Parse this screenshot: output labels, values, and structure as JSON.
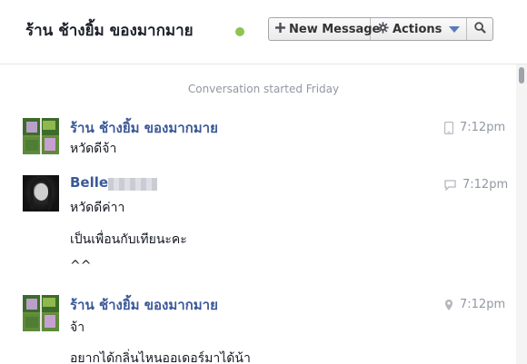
{
  "header": {
    "title": "ร้าน ช้างยิ้ม ของมากมาย",
    "online_color": "#8fc355",
    "new_message_label": "New Message",
    "new_message_icon": "plus-icon",
    "actions_label": "Actions",
    "actions_icon": "gear-icon",
    "search_icon": "search-icon"
  },
  "conversation": {
    "started_text": "Conversation started Friday",
    "messages": [
      {
        "sender": "ร้าน ช้างยิ้ม ของมากมาย",
        "time": "7:12pm",
        "source_icon": "mobile-icon",
        "lines": [
          "หวัดดีจ้า"
        ]
      },
      {
        "sender": "Belle",
        "time": "7:12pm",
        "source_icon": "chat-icon",
        "lines": [
          "หวัดดีค่าา",
          "เป็นเพื่อนกับเทียนะคะ",
          "^^"
        ]
      },
      {
        "sender": "ร้าน ช้างยิ้ม ของมากมาย",
        "time": "7:12pm",
        "source_icon": "location-icon",
        "lines": [
          "จ้า",
          "อยากได้กลิ่นไหนออเดอร์มาได้น้า"
        ]
      }
    ]
  },
  "colors": {
    "sender_name": "#3b5998",
    "timestamp": "#9197a3"
  }
}
